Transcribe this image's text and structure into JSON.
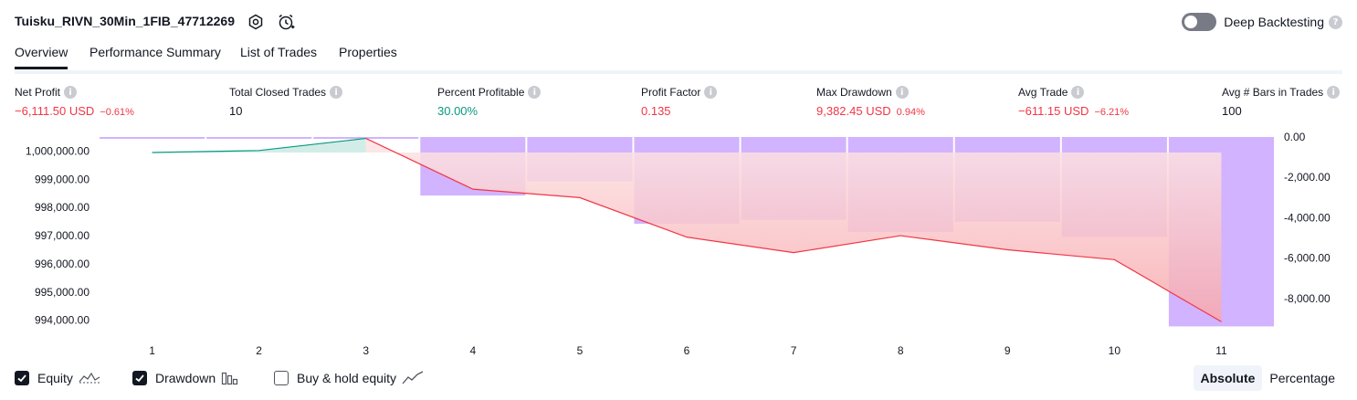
{
  "header": {
    "title": "Tuisku_RIVN_30Min_1FIB_47712269",
    "settings_icon": "gear-icon",
    "alert_icon": "add-alert-clock-icon",
    "deep_backtesting": {
      "label": "Deep Backtesting",
      "enabled": false,
      "help_icon": "question-icon"
    }
  },
  "tabs": [
    {
      "label": "Overview",
      "active": true
    },
    {
      "label": "Performance Summary",
      "active": false
    },
    {
      "label": "List of Trades",
      "active": false
    },
    {
      "label": "Properties",
      "active": false
    }
  ],
  "metrics": [
    {
      "label": "Net Profit",
      "value": "−6,111.50 USD",
      "pct": "−0.61%",
      "tone": "red"
    },
    {
      "label": "Total Closed Trades",
      "value": "10",
      "pct": "",
      "tone": "dark"
    },
    {
      "label": "Percent Profitable",
      "value": "30.00%",
      "pct": "",
      "tone": "green"
    },
    {
      "label": "Profit Factor",
      "value": "0.135",
      "pct": "",
      "tone": "red"
    },
    {
      "label": "Max Drawdown",
      "value": "9,382.45 USD",
      "pct": "0.94%",
      "tone": "red"
    },
    {
      "label": "Avg Trade",
      "value": "−611.15 USD",
      "pct": "−6.21%",
      "tone": "red"
    },
    {
      "label": "Avg # Bars in Trades",
      "value": "100",
      "pct": "",
      "tone": "dark"
    }
  ],
  "chart_data": {
    "type": "line",
    "x": [
      1,
      2,
      3,
      4,
      5,
      6,
      7,
      8,
      9,
      10,
      11
    ],
    "series": [
      {
        "values": [
          999950,
          1000020,
          1000450,
          998650,
          998350,
          996950,
          996400,
          997000,
          996500,
          996150,
          993950
        ],
        "axis": "left",
        "style": "line",
        "color_above_start": "#089981",
        "color_below_start": "#f23645"
      },
      {
        "values": [
          0,
          -50,
          -50,
          -2900,
          -2200,
          -4300,
          -4100,
          -4700,
          -4200,
          -4950,
          -9382
        ],
        "axis": "right",
        "style": "bar",
        "color": "#d1b3ff"
      }
    ],
    "y_left": {
      "ticks": [
        "1,000,000.00",
        "999,000.00",
        "998,000.00",
        "997,000.00",
        "996,000.00",
        "995,000.00",
        "994,000.00"
      ],
      "range": [
        993700,
        1000500
      ]
    },
    "y_right": {
      "ticks": [
        "0.00",
        "-2,000.00",
        "-4,000.00",
        "-6,000.00",
        "-8,000.00"
      ],
      "range": [
        -9500,
        0
      ]
    },
    "baseline": 999950
  },
  "legend": [
    {
      "label": "Equity",
      "checked": true,
      "icon": "equity-line-icon"
    },
    {
      "label": "Drawdown",
      "checked": true,
      "icon": "drawdown-bars-icon"
    },
    {
      "label": "Buy & hold equity",
      "checked": false,
      "icon": "buy-hold-line-icon"
    }
  ],
  "modes": [
    {
      "label": "Absolute",
      "active": true
    },
    {
      "label": "Percentage",
      "active": false
    }
  ]
}
